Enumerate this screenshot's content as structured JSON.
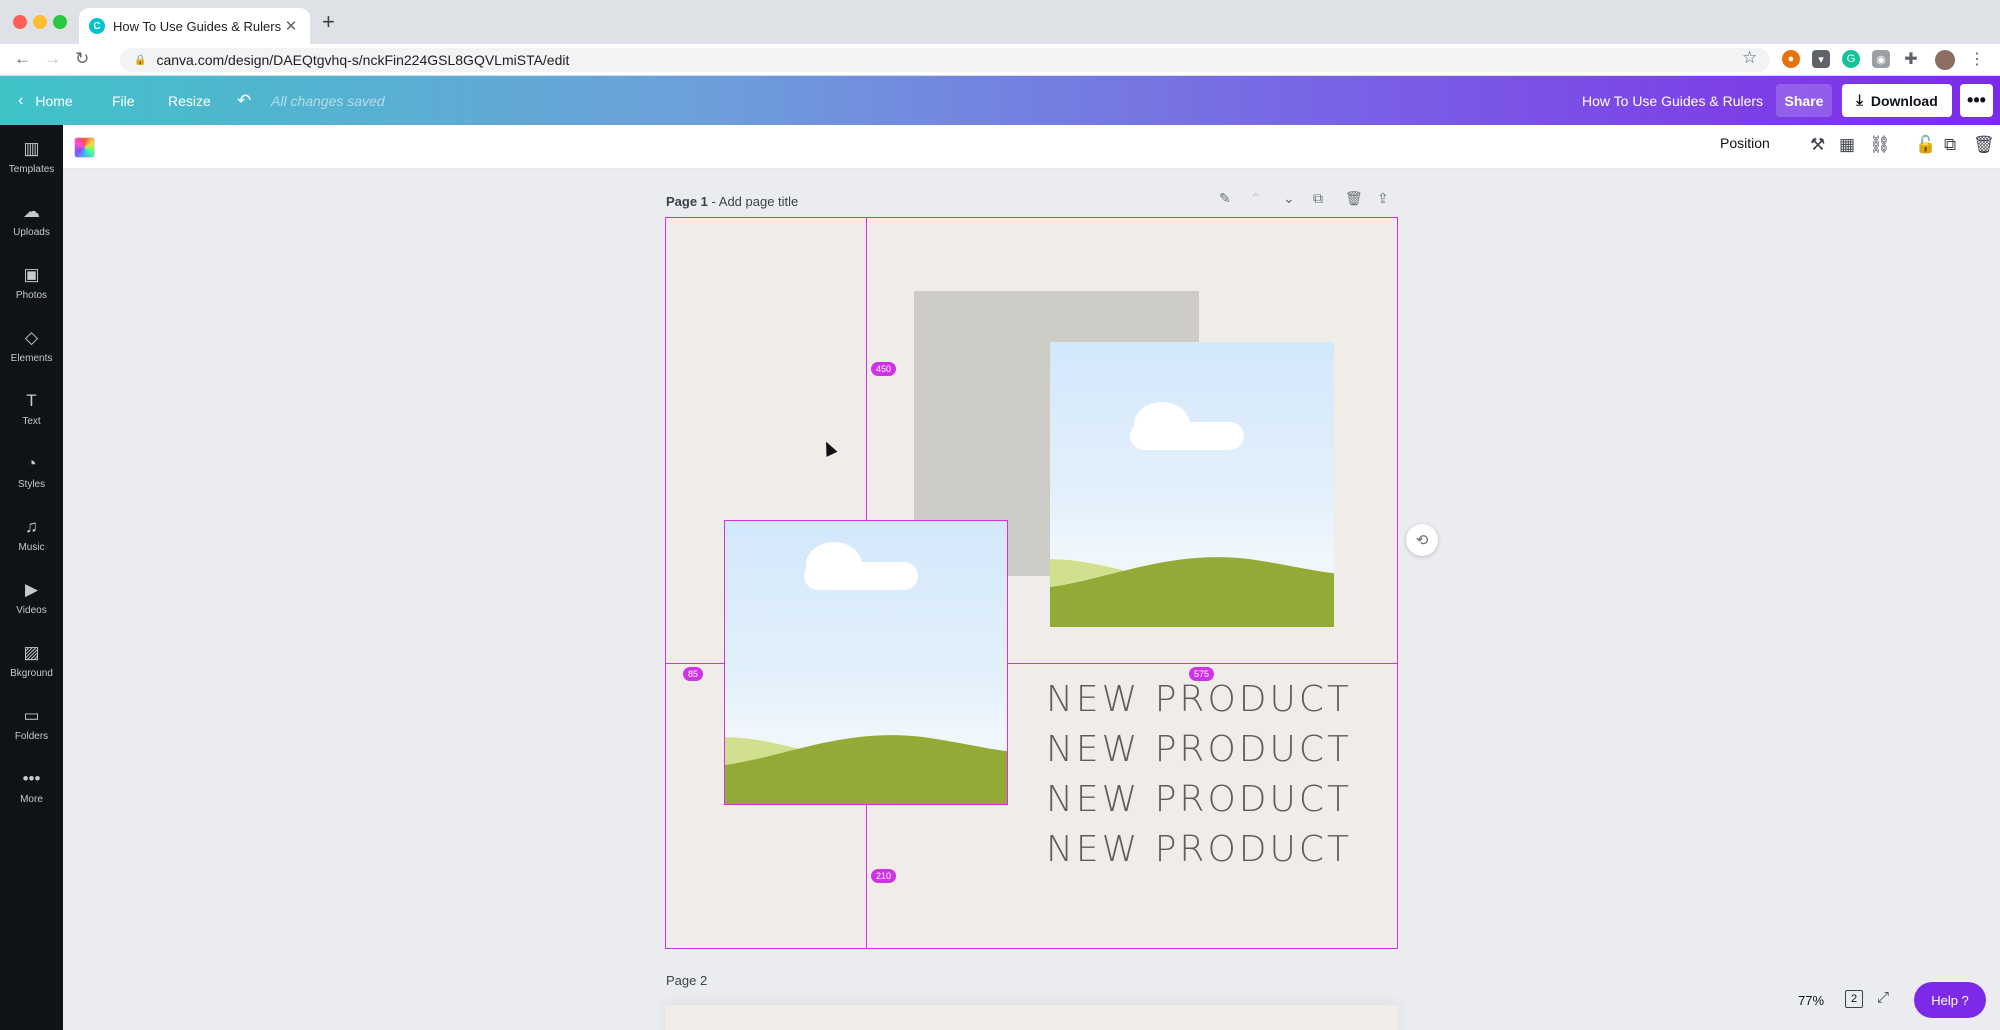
{
  "browser": {
    "tab_title": "How To Use Guides & Rulers -",
    "tab_favicon": "C",
    "url": "canva.com/design/DAEQtgvhq-s/nckFin224GSL8GQVLmiSTA/edit"
  },
  "header": {
    "home": "Home",
    "file": "File",
    "resize": "Resize",
    "saved_status": "All changes saved",
    "design_title": "How To Use Guides & Rulers",
    "share": "Share",
    "download": "Download"
  },
  "sidebar": {
    "items": [
      {
        "label": "Templates",
        "icon": "templates-icon"
      },
      {
        "label": "Uploads",
        "icon": "uploads-icon"
      },
      {
        "label": "Photos",
        "icon": "photos-icon"
      },
      {
        "label": "Elements",
        "icon": "elements-icon"
      },
      {
        "label": "Text",
        "icon": "text-icon"
      },
      {
        "label": "Styles",
        "icon": "styles-icon"
      },
      {
        "label": "Music",
        "icon": "music-icon"
      },
      {
        "label": "Videos",
        "icon": "videos-icon"
      },
      {
        "label": "Bkground",
        "icon": "background-icon"
      },
      {
        "label": "Folders",
        "icon": "folders-icon"
      },
      {
        "label": "More",
        "icon": "more-icon"
      }
    ]
  },
  "toolbar": {
    "position": "Position"
  },
  "pages": {
    "page1_label": "Page 1",
    "page1_title_placeholder": "Add page title",
    "page2_label": "Page 2"
  },
  "design": {
    "text_lines": [
      "NEW PRODUCT",
      "NEW PRODUCT",
      "NEW PRODUCT",
      "NEW PRODUCT"
    ],
    "measurements": {
      "top": "450",
      "left": "85",
      "right": "575",
      "bottom": "210"
    }
  },
  "footer": {
    "zoom": "77%",
    "page_count": "2",
    "help": "Help ?"
  },
  "colors": {
    "guide": "#cf33e8",
    "accent": "#7d2ae8",
    "page_bg": "#f0ece8"
  }
}
